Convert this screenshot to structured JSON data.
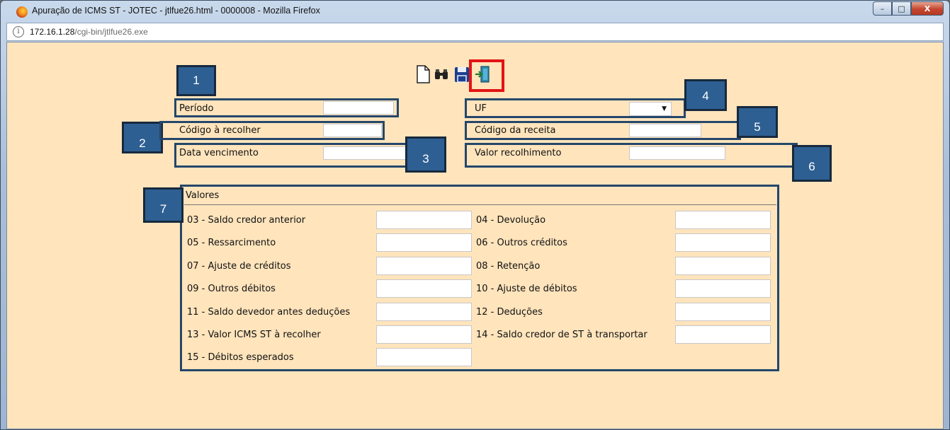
{
  "window": {
    "title": "Apuração de ICMS ST - JOTEC - jtlfue26.html - 0000008 - Mozilla Firefox",
    "buttons": {
      "minimize": "–",
      "maximize": "□",
      "close": "X"
    }
  },
  "urlbar": {
    "info_icon": "i",
    "host": "172.16.1.28",
    "path": "/cgi-bin/jtlfue26.exe"
  },
  "toolbar": {
    "icons": [
      "new-document-icon",
      "binoculars-search-icon",
      "floppy-save-icon",
      "exit-door-icon"
    ]
  },
  "form": {
    "periodo_label": "Período",
    "codigo_recolher_label": "Código à recolher",
    "data_vencimento_label": "Data vencimento",
    "uf_label": "UF",
    "uf_value": "",
    "codigo_receita_label": "Código da receita",
    "valor_recolhimento_label": "Valor recolhimento"
  },
  "valores": {
    "title": "Valores",
    "left": [
      "03 - Saldo credor anterior",
      "05 - Ressarcimento",
      "07 - Ajuste de créditos",
      "09 - Outros débitos",
      "11 - Saldo devedor antes deduções",
      "13 - Valor ICMS ST à recolher",
      "15 - Débitos esperados"
    ],
    "right": [
      "04 - Devolução",
      "06 - Outros créditos",
      "08 - Retenção",
      "10 - Ajuste de débitos",
      "12 - Deduções",
      "14 - Saldo credor de ST à transportar"
    ]
  },
  "badges": [
    "1",
    "2",
    "3",
    "4",
    "5",
    "6",
    "7"
  ],
  "colors": {
    "background": "#ffe4bc",
    "callout_border": "#24476b",
    "badge_fill": "#2e5f92",
    "highlight": "#e21414"
  }
}
